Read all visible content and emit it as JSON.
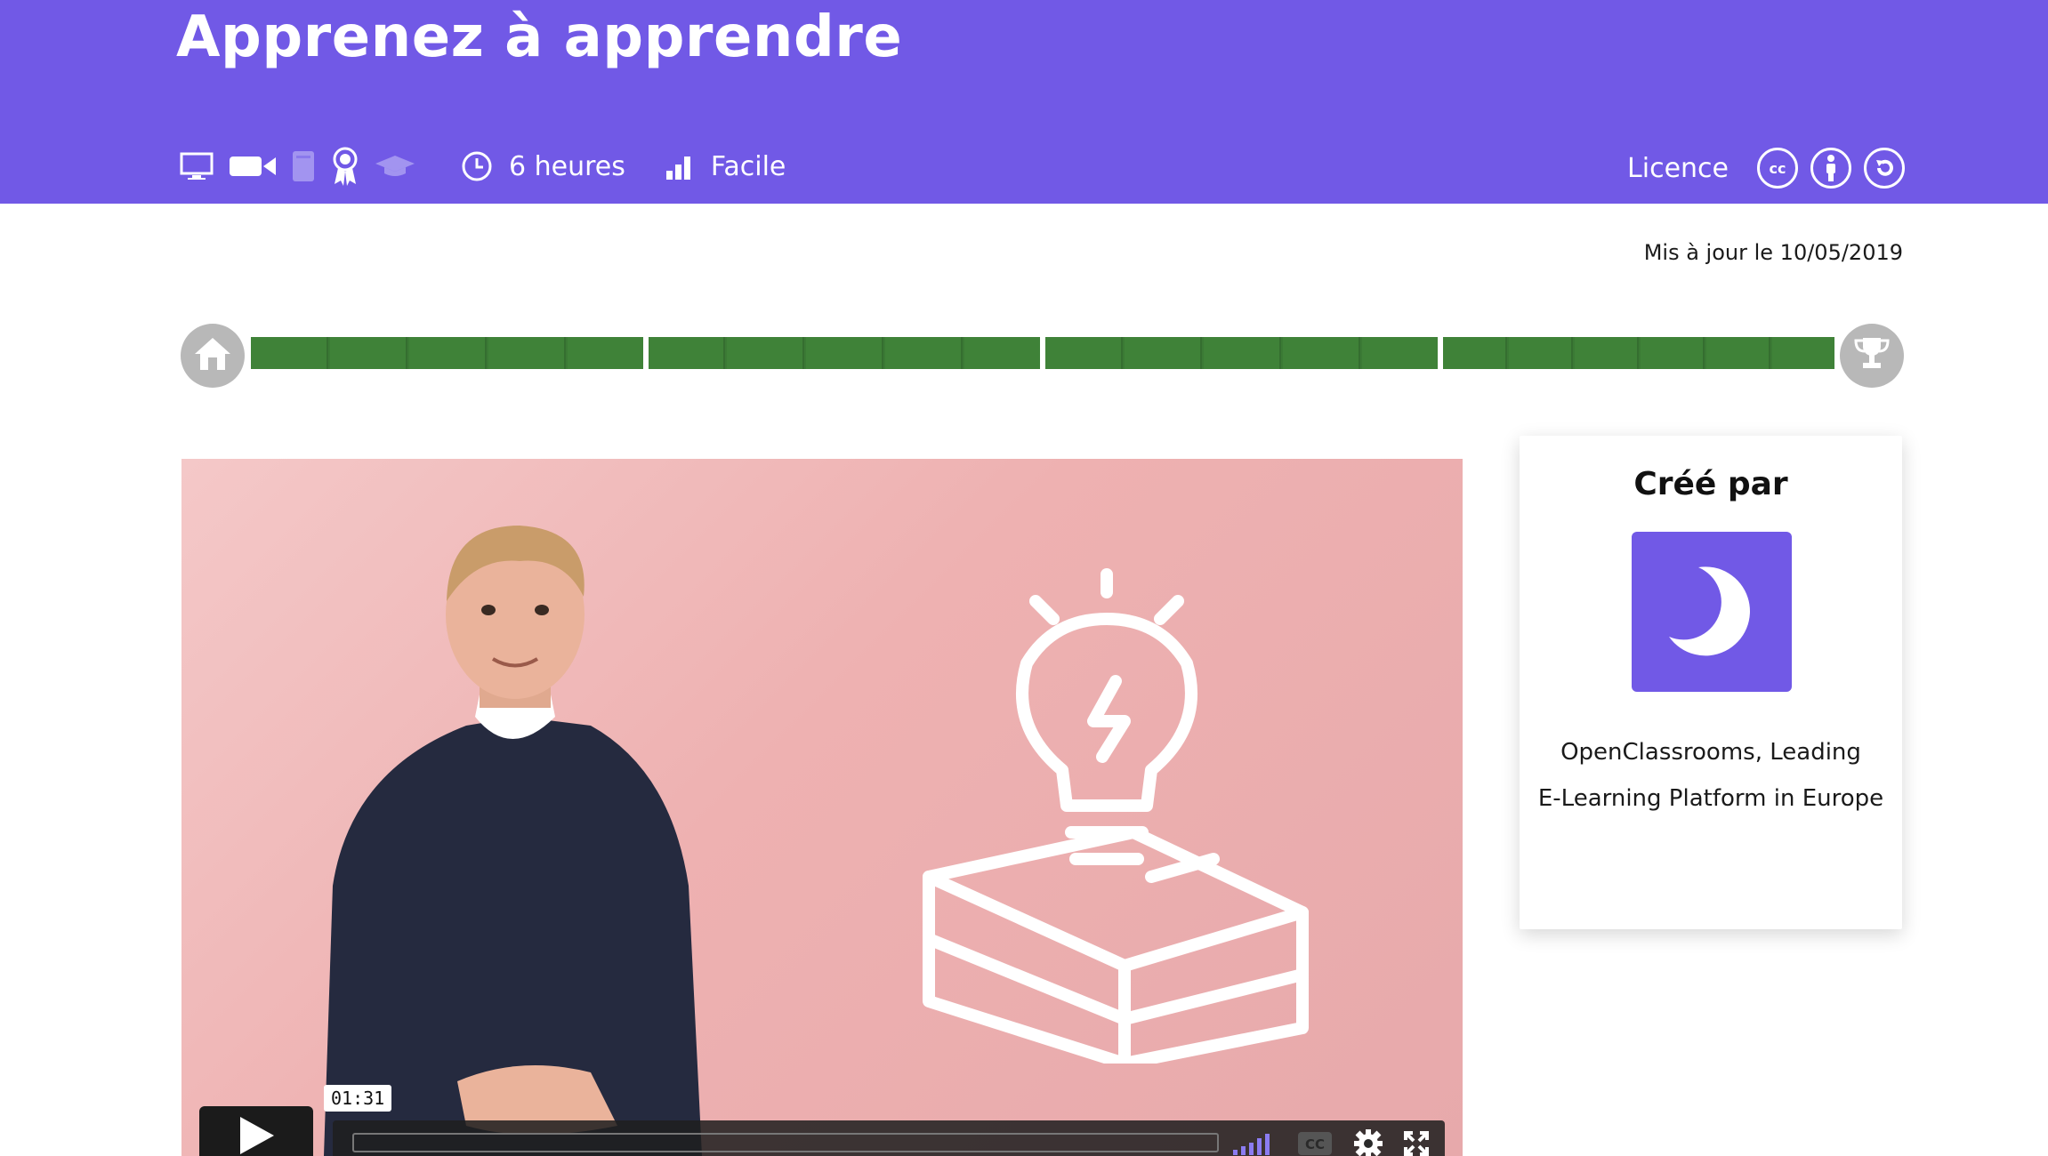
{
  "header": {
    "title": "Apprenez à apprendre",
    "background": "#7159e6",
    "icons": [
      "monitor-icon",
      "video-camera-icon",
      "book-icon",
      "certificate-icon",
      "graduation-cap-icon"
    ],
    "duration_label": "6 heures",
    "difficulty_label": "Facile",
    "licence_label": "Licence",
    "licence_icons": [
      "cc-icon",
      "attribution-icon",
      "share-alike-icon"
    ]
  },
  "updated_label": "Mis à jour le 10/05/2019",
  "progress": {
    "start_icon": "home-icon",
    "end_icon": "trophy-icon",
    "segments": 4,
    "fill_color": "#3f8238",
    "completion": 1.0
  },
  "video": {
    "time_label": "01:31",
    "controls": [
      "play-icon",
      "volume-icon",
      "captions-icon",
      "settings-icon",
      "fullscreen-icon"
    ]
  },
  "creator": {
    "heading": "Créé par",
    "name_line1": "OpenClassrooms, Leading",
    "name_line2": "E-Learning Platform in Europe"
  }
}
